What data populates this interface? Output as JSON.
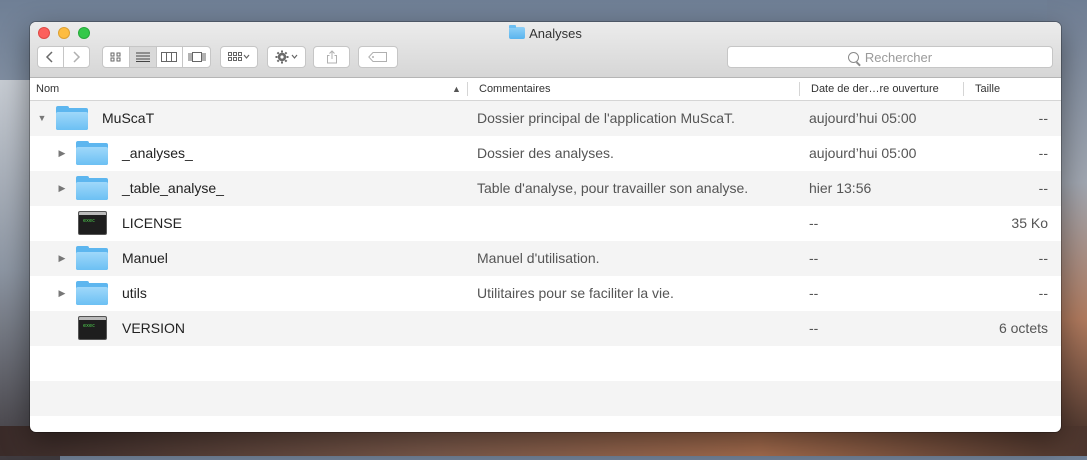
{
  "window": {
    "title": "Analyses"
  },
  "toolbar": {
    "back_icon": "chevron-left",
    "forward_icon": "chevron-right",
    "views": [
      "icon-view",
      "list-view",
      "column-view",
      "gallery-view"
    ],
    "active_view": "list-view",
    "search_placeholder": "Rechercher"
  },
  "columns": {
    "name": "Nom",
    "comments": "Commentaires",
    "date": "Date de der…re ouverture",
    "size": "Taille"
  },
  "rows": [
    {
      "name": "MuScaT",
      "comment": "Dossier principal de l'application MuScaT.",
      "date": "aujourd’hui 05:00",
      "size": "--",
      "kind": "folder",
      "disclosure": "▼",
      "depth": 0
    },
    {
      "name": "_analyses_",
      "comment": "Dossier des analyses.",
      "date": "aujourd’hui 05:00",
      "size": "--",
      "kind": "folder",
      "disclosure": "▶",
      "depth": 1
    },
    {
      "name": "_table_analyse_",
      "comment": "Table d'analyse, pour travailler son analyse.",
      "date": "hier 13:56",
      "size": "--",
      "kind": "folder",
      "disclosure": "▶",
      "depth": 1
    },
    {
      "name": "LICENSE",
      "comment": "",
      "date": "--",
      "size": "35 Ko",
      "kind": "exec",
      "disclosure": "",
      "depth": 1
    },
    {
      "name": "Manuel",
      "comment": "Manuel d'utilisation.",
      "date": "--",
      "size": "--",
      "kind": "folder",
      "disclosure": "▶",
      "depth": 1
    },
    {
      "name": "utils",
      "comment": "Utilitaires pour se faciliter la vie.",
      "date": "--",
      "size": "--",
      "kind": "folder",
      "disclosure": "▶",
      "depth": 1
    },
    {
      "name": "VERSION",
      "comment": "",
      "date": "--",
      "size": "6 octets",
      "kind": "exec",
      "disclosure": "",
      "depth": 1
    }
  ]
}
